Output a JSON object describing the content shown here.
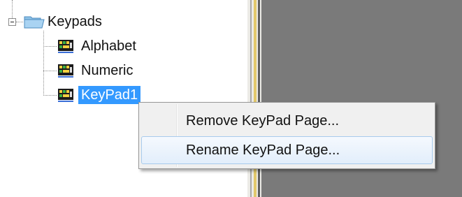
{
  "tree": {
    "root": {
      "label": "Keypads",
      "icon": "folder-icon",
      "expanded": true
    },
    "children": [
      {
        "label": "Alphabet",
        "icon": "keypad-page-icon",
        "selected": false
      },
      {
        "label": "Numeric",
        "icon": "keypad-page-icon",
        "selected": false
      },
      {
        "label": "KeyPad1",
        "icon": "keypad-page-icon",
        "selected": true
      }
    ]
  },
  "context_menu": {
    "items": [
      {
        "label": "Remove KeyPad Page...",
        "highlighted": false
      },
      {
        "label": "Rename KeyPad Page...",
        "highlighted": true
      }
    ]
  },
  "colors": {
    "selection": "#3399ff",
    "workspace": "#7a7a7a",
    "splitter_accent": "#e2c86a",
    "menu_highlight": "#e2eefb"
  }
}
